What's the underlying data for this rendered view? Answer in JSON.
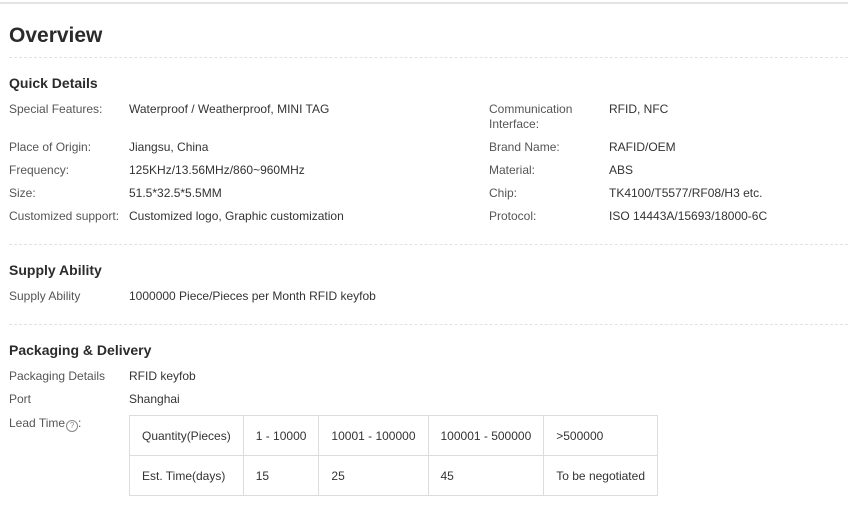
{
  "title": "Overview",
  "quick_details": {
    "heading": "Quick Details",
    "left": [
      {
        "label": "Special Features:",
        "value": "Waterproof / Weatherproof, MINI TAG"
      },
      {
        "label": "Place of Origin:",
        "value": "Jiangsu, China"
      },
      {
        "label": "Frequency:",
        "value": "125KHz/13.56MHz/860~960MHz"
      },
      {
        "label": "Size:",
        "value": "51.5*32.5*5.5MM"
      },
      {
        "label": "Customized support:",
        "value": "Customized logo, Graphic customization"
      }
    ],
    "right": [
      {
        "label_line1": "Communication",
        "label_line2": "Interface:",
        "value": "RFID, NFC"
      },
      {
        "label": "Brand Name:",
        "value": "RAFID/OEM"
      },
      {
        "label": "Material:",
        "value": "ABS"
      },
      {
        "label": "Chip:",
        "value": "TK4100/T5577/RF08/H3 etc."
      },
      {
        "label": "Protocol:",
        "value": "ISO 14443A/15693/18000-6C"
      }
    ]
  },
  "supply_ability": {
    "heading": "Supply Ability",
    "label": "Supply Ability",
    "value": "1000000 Piece/Pieces per Month RFID keyfob"
  },
  "packaging_delivery": {
    "heading": "Packaging & Delivery",
    "packaging_label": "Packaging Details",
    "packaging_value": "RFID keyfob",
    "port_label": "Port",
    "port_value": "Shanghai",
    "lead_time_label": "Lead Time",
    "help_glyph": "?",
    "table": {
      "row1": [
        "Quantity(Pieces)",
        "1 - 10000",
        "10001 - 100000",
        "100001 - 500000",
        ">500000"
      ],
      "row2": [
        "Est. Time(days)",
        "15",
        "25",
        "45",
        "To be negotiated"
      ]
    }
  }
}
